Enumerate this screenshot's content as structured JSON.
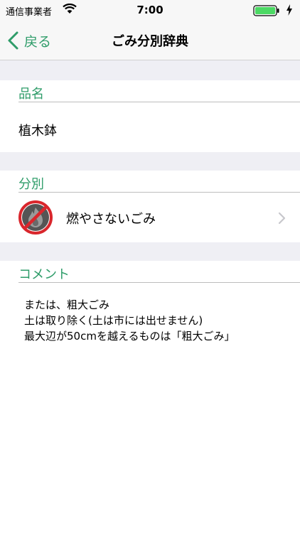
{
  "status_bar": {
    "carrier": "通信事業者",
    "time": "7:00",
    "icons": [
      "wifi-icon",
      "battery-icon",
      "charging-bolt-icon"
    ]
  },
  "nav": {
    "back_label": "戻る",
    "title": "ごみ分別辞典",
    "accent_color": "#2e9c69"
  },
  "item": {
    "header": "品名",
    "name": "植木鉢"
  },
  "category": {
    "header": "分別",
    "label": "燃やさないごみ",
    "icon": "no-burn-icon"
  },
  "comment": {
    "header": "コメント",
    "lines": [
      "または、粗大ごみ",
      "土は取り除く(土は市には出せません)",
      "最大辺が50cmを越えるものは「粗大ごみ」"
    ]
  }
}
